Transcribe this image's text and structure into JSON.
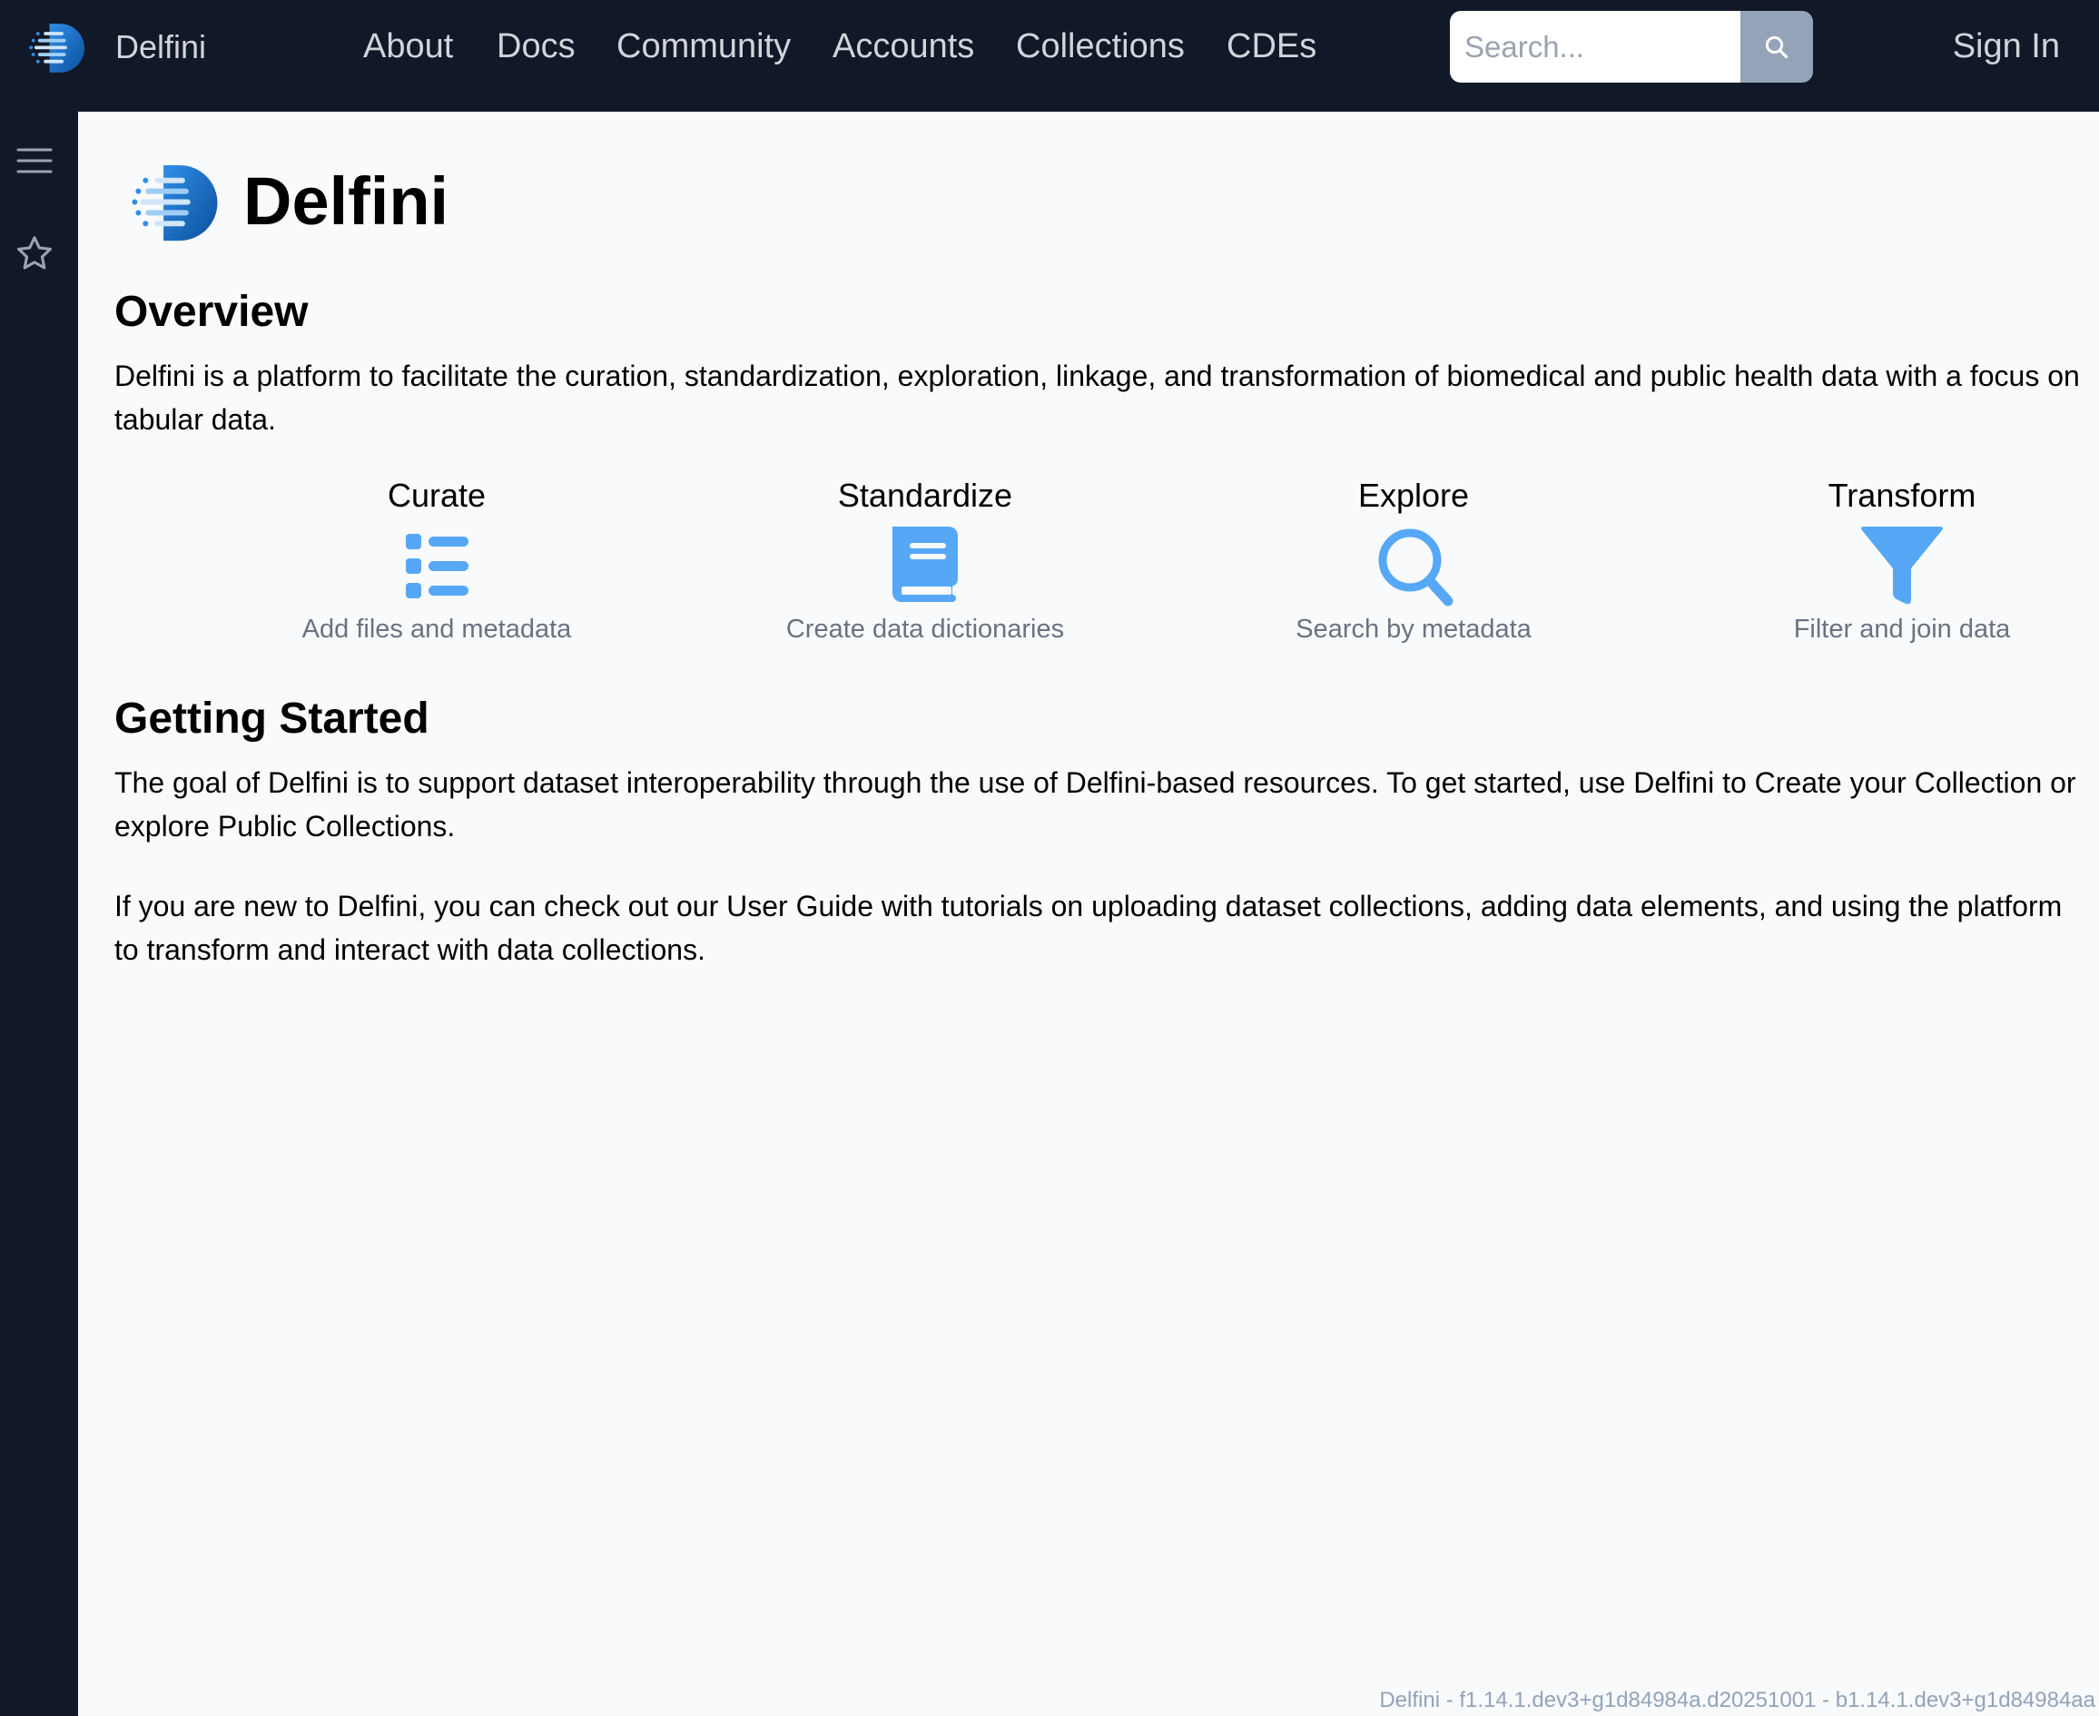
{
  "navbar": {
    "brand": "Delfini",
    "links": [
      "About",
      "Docs",
      "Community",
      "Accounts",
      "Collections",
      "CDEs"
    ],
    "search": {
      "placeholder": "Search...",
      "value": ""
    },
    "search_icon": "magnifier-icon",
    "sign_in": "Sign In"
  },
  "sidebar": {
    "items": [
      {
        "icon": "hamburger-menu-icon"
      },
      {
        "icon": "star-icon"
      }
    ]
  },
  "main": {
    "title": "Delfini",
    "overview": {
      "heading": "Overview",
      "text": "Delfini is a platform to facilitate the curation, standardization, exploration, linkage, and transformation of biomedical and public health data with a focus on tabular data."
    },
    "features": [
      {
        "title": "Curate",
        "desc": "Add files and metadata",
        "icon": "list-icon"
      },
      {
        "title": "Standardize",
        "desc": "Create data dictionaries",
        "icon": "book-icon"
      },
      {
        "title": "Explore",
        "desc": "Search by metadata",
        "icon": "magnifier-icon"
      },
      {
        "title": "Transform",
        "desc": "Filter and join data",
        "icon": "funnel-icon"
      }
    ],
    "getting_started": {
      "heading": "Getting Started",
      "p1": "The goal of Delfini is to support dataset interoperability through the use of Delfini-based resources. To get started, use Delfini to Create your Collection or explore Public Collections.",
      "p2": "If you are new to Delfini, you can check out our User Guide with tutorials on uploading dataset collections, adding data elements, and using the platform to transform and interact with data collections."
    }
  },
  "footer": {
    "version": "Delfini - f1.14.1.dev3+g1d84984a.d20251001 - b1.14.1.dev3+g1d84984aa"
  },
  "colors": {
    "navbar_bg": "#111827",
    "page_bg": "#f8fafc",
    "accent_icon": "#56a7f5",
    "logo_dark": "#0b4f9c",
    "logo_light": "#2f8ee8",
    "muted_text": "#6b7280"
  }
}
